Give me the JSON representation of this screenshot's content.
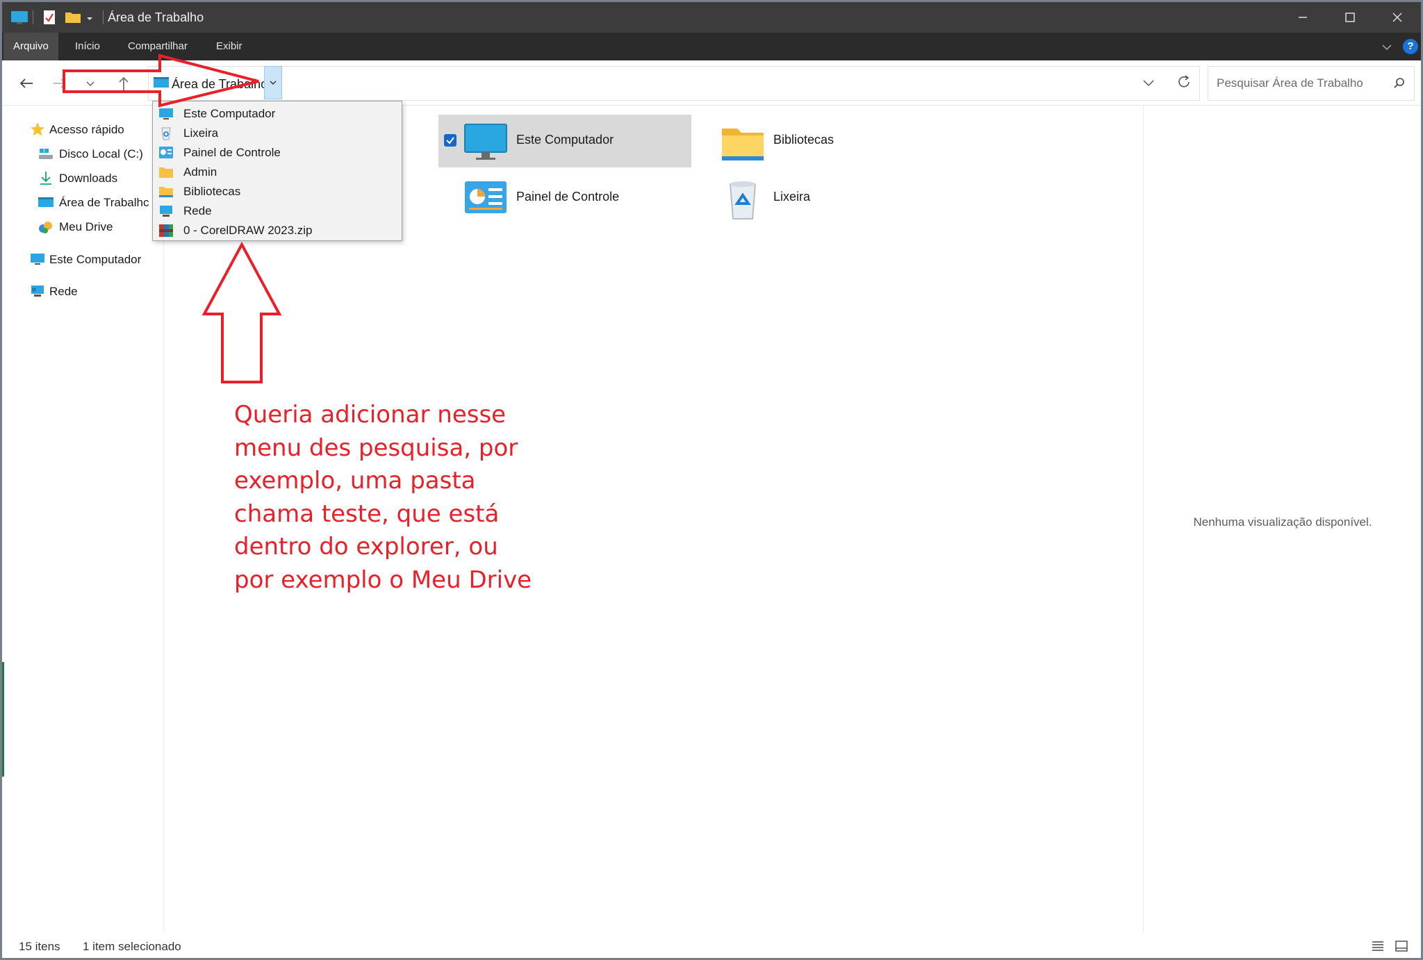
{
  "window": {
    "title": "Área de Trabalho",
    "controls": [
      "minimize",
      "maximize",
      "close"
    ]
  },
  "ribbon": {
    "tabs": [
      {
        "label": "Arquivo",
        "active": true
      },
      {
        "label": "Início",
        "active": false
      },
      {
        "label": "Compartilhar",
        "active": false
      },
      {
        "label": "Exibir",
        "active": false
      }
    ],
    "help_label": "?"
  },
  "address": {
    "breadcrumb": "Área de Trabalho",
    "search_placeholder": "Pesquisar Área de Trabalho"
  },
  "breadcrumb_dropdown": {
    "items": [
      {
        "label": "Este Computador",
        "icon": "monitor-icon"
      },
      {
        "label": "Lixeira",
        "icon": "recycle-bin-icon"
      },
      {
        "label": "Painel de Controle",
        "icon": "control-panel-icon"
      },
      {
        "label": "Admin",
        "icon": "folder-icon"
      },
      {
        "label": "Bibliotecas",
        "icon": "folder-icon"
      },
      {
        "label": "Rede",
        "icon": "network-icon"
      },
      {
        "label": "0 - CorelDRAW 2023.zip",
        "icon": "zip-archive-icon"
      }
    ]
  },
  "nav_pane": {
    "quick_access": "Acesso rápido",
    "items": [
      {
        "label": "Disco Local (C:)",
        "icon": "drive-icon"
      },
      {
        "label": "Downloads",
        "icon": "download-icon"
      },
      {
        "label": "Área de Trabalhc",
        "icon": "desktop-icon"
      },
      {
        "label": "Meu Drive",
        "icon": "google-drive-icon"
      }
    ],
    "this_pc": "Este Computador",
    "network": "Rede"
  },
  "content": {
    "items": [
      {
        "label": "Este Computador",
        "icon": "monitor-icon",
        "selected": true
      },
      {
        "label": "Bibliotecas",
        "icon": "folder-icon",
        "selected": false
      },
      {
        "label": "Painel de Controle",
        "icon": "control-panel-icon",
        "selected": false
      },
      {
        "label": "Lixeira",
        "icon": "recycle-bin-icon",
        "selected": false
      }
    ]
  },
  "preview": {
    "message": "Nenhuma visualização disponível."
  },
  "status": {
    "count": "15 itens",
    "selection": "1 item selecionado"
  },
  "annotation": {
    "lines": [
      "Queria adicionar nesse",
      "menu des pesquisa, por",
      "exemplo, uma pasta",
      "chama teste, que está",
      "dentro do explorer, ou",
      "por exemplo o Meu Drive"
    ],
    "color": "#e8202a"
  },
  "colors": {
    "titlebar": "#3c3c3c",
    "ribbon": "#2b2b2b",
    "accent": "#1a66c7",
    "selection": "#d9d9d9"
  }
}
